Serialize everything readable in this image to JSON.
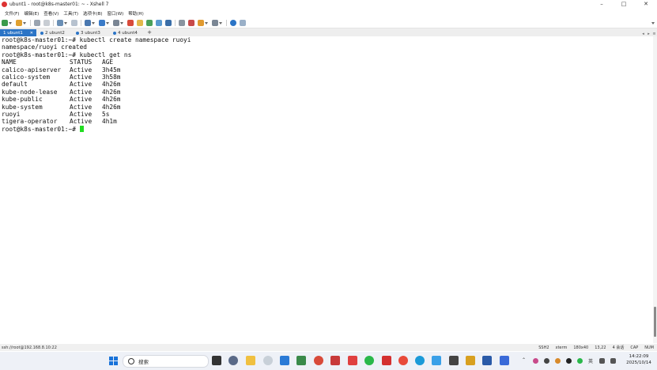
{
  "window": {
    "title": "ubunt1 - root@k8s-master01: ~ - Xshell 7",
    "controls": [
      "–",
      "□",
      "✕"
    ]
  },
  "menu": [
    "文件(F)",
    "编辑(E)",
    "查看(V)",
    "工具(T)",
    "选项卡(B)",
    "窗口(W)",
    "帮助(H)"
  ],
  "tabs": [
    {
      "label": "1 ubunt1",
      "active": true
    },
    {
      "label": "2 ubunt2",
      "active": false
    },
    {
      "label": "3 ubunt3",
      "active": false
    },
    {
      "label": "4 ubunt4",
      "active": false
    }
  ],
  "terminal": {
    "lines": [
      "root@k8s-master01:~# kubectl create namespace ruoyi",
      "namespace/ruoyi created",
      "root@k8s-master01:~# kubectl get ns"
    ],
    "table_header": [
      "NAME",
      "STATUS",
      "AGE"
    ],
    "table_rows": [
      [
        "calico-apiserver",
        "Active",
        "3h45m"
      ],
      [
        "calico-system",
        "Active",
        "3h58m"
      ],
      [
        "default",
        "Active",
        "4h26m"
      ],
      [
        "kube-node-lease",
        "Active",
        "4h26m"
      ],
      [
        "kube-public",
        "Active",
        "4h26m"
      ],
      [
        "kube-system",
        "Active",
        "4h26m"
      ],
      [
        "ruoyi",
        "Active",
        "5s"
      ],
      [
        "tigera-operator",
        "Active",
        "4h1m"
      ]
    ],
    "prompt": "root@k8s-master01:~# ",
    "cursor_color": "#22dd22"
  },
  "statusbar": {
    "connection": "ssh://root@192.168.8.10:22",
    "protocol": "SSH2",
    "term": "xterm",
    "size": "180x40",
    "position": "13,22",
    "sessions": "4 会话",
    "caps": "CAP",
    "num": "NUM"
  },
  "taskbar": {
    "search_placeholder": "搜索",
    "ime": "英",
    "time": "14:22:09",
    "date": "2025/10/14"
  },
  "colors": {
    "tab_active": "#2b74c6",
    "start": "#1a73d9"
  }
}
